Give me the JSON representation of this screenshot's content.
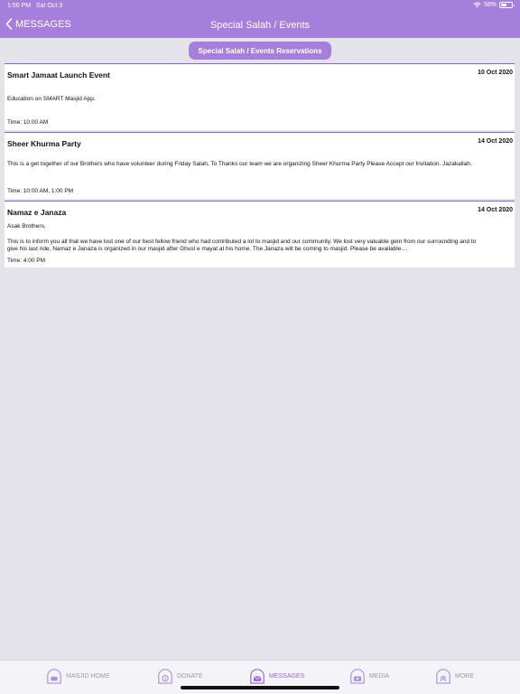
{
  "status": {
    "time": "1:50 PM",
    "date": "Sat Oct 3",
    "battery": "58%",
    "battery_level": 0.58
  },
  "nav": {
    "back_label": "MESSAGES",
    "title": "Special Salah / Events"
  },
  "reserve_button": "Special Salah / Events Reservations",
  "events": [
    {
      "title": "Smart Jamaat Launch Event",
      "date": "10 Oct 2020",
      "body": "Education on SMART Masjid App.",
      "time": "Time: 10:00 AM"
    },
    {
      "title": "Sheer Khurma Party",
      "date": "14 Oct 2020",
      "body": "This is a get together of our Brothers who have volunteer during Friday Salah, To Thanks our team we are organizing Sheer Khurma Party Please Accept our Invitation. Jazakallah.",
      "time": "Time: 10:00 AM, 1:00 PM"
    },
    {
      "title": "Namaz e Janaza",
      "date": "14 Oct 2020",
      "greeting": "Asak Brothers,",
      "body": "This is to inform you all that we have lost one of our best fellow friend who had contributed a lot to masjid and our community. We lost very valuable gem from our surrounding and to give his last ride, Namaz e Janaza is organized in our masjid after Ghusl e mayat at his home. The Janaza will be coming to masjid. Please be available....",
      "time": "Time: 4:00 PM"
    }
  ],
  "tabs": [
    {
      "label": "MASJID HOME",
      "icon": "masjid-home-icon"
    },
    {
      "label": "DONATE",
      "icon": "donate-icon"
    },
    {
      "label": "MESSAGES",
      "icon": "messages-icon",
      "active": true
    },
    {
      "label": "MEDIA",
      "icon": "media-icon"
    },
    {
      "label": "MORE",
      "icon": "more-icon"
    }
  ],
  "colors": {
    "accent": "#a67fdd",
    "active_tab": "#9466d9",
    "inactive_tab": "#9b9aa2"
  }
}
